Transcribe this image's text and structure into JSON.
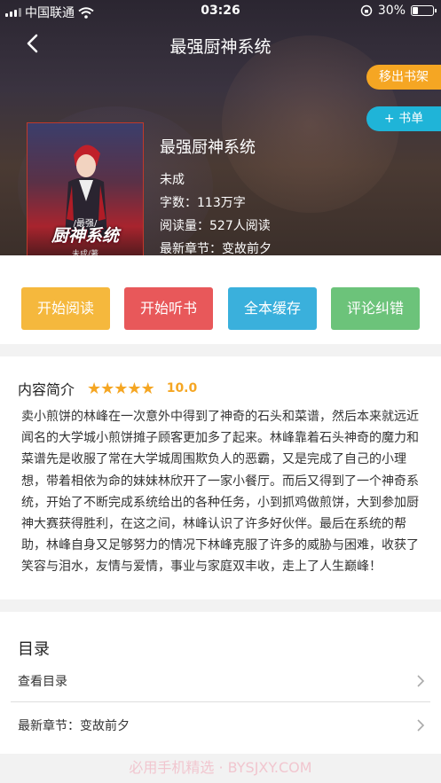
{
  "status": {
    "carrier": "中国联通",
    "time": "03:26",
    "battery": "30%",
    "battery_level": 0.3
  },
  "nav": {
    "title": "最强厨神系统"
  },
  "shelf": {
    "remove_label": "移出书架",
    "add_label": "+ 书单"
  },
  "cover": {
    "small_text": "/最强/",
    "title_text": "厨神系统",
    "author_text": "未成/著"
  },
  "book": {
    "title": "最强厨神系统",
    "author": "未成",
    "words": "字数：113万字",
    "reads": "阅读量：527人阅读",
    "latest": "最新章节：变故前夕"
  },
  "actions": {
    "read": "开始阅读",
    "listen": "开始听书",
    "cache": "全本缓存",
    "report": "评论纠错"
  },
  "intro": {
    "heading": "内容简介",
    "stars": "★★★★★",
    "rating": "10.0",
    "text": "卖小煎饼的林峰在一次意外中得到了神奇的石头和菜谱，然后本来就远近闻名的大学城小煎饼摊子顾客更加多了起来。林峰靠着石头神奇的魔力和菜谱先是收服了常在大学城周围欺负人的恶霸，又是完成了自己的小理想，带着相依为命的妹妹林欣开了一家小餐厅。而后又得到了一个神奇系统，开始了不断完成系统给出的各种任务，小到抓鸡做煎饼，大到参加厨神大赛获得胜利，在这之间，林峰认识了许多好伙伴。最后在系统的帮助，林峰自身又足够努力的情况下林峰克服了许多的威胁与困难，收获了笑容与泪水，友情与爱情，事业与家庭双丰收，走上了人生巅峰！"
  },
  "catalog": {
    "title": "目录",
    "view": "查看目录",
    "latest": "最新章节：变故前夕"
  },
  "watermark": "必用手机精选 · BYSJXY.COM"
}
